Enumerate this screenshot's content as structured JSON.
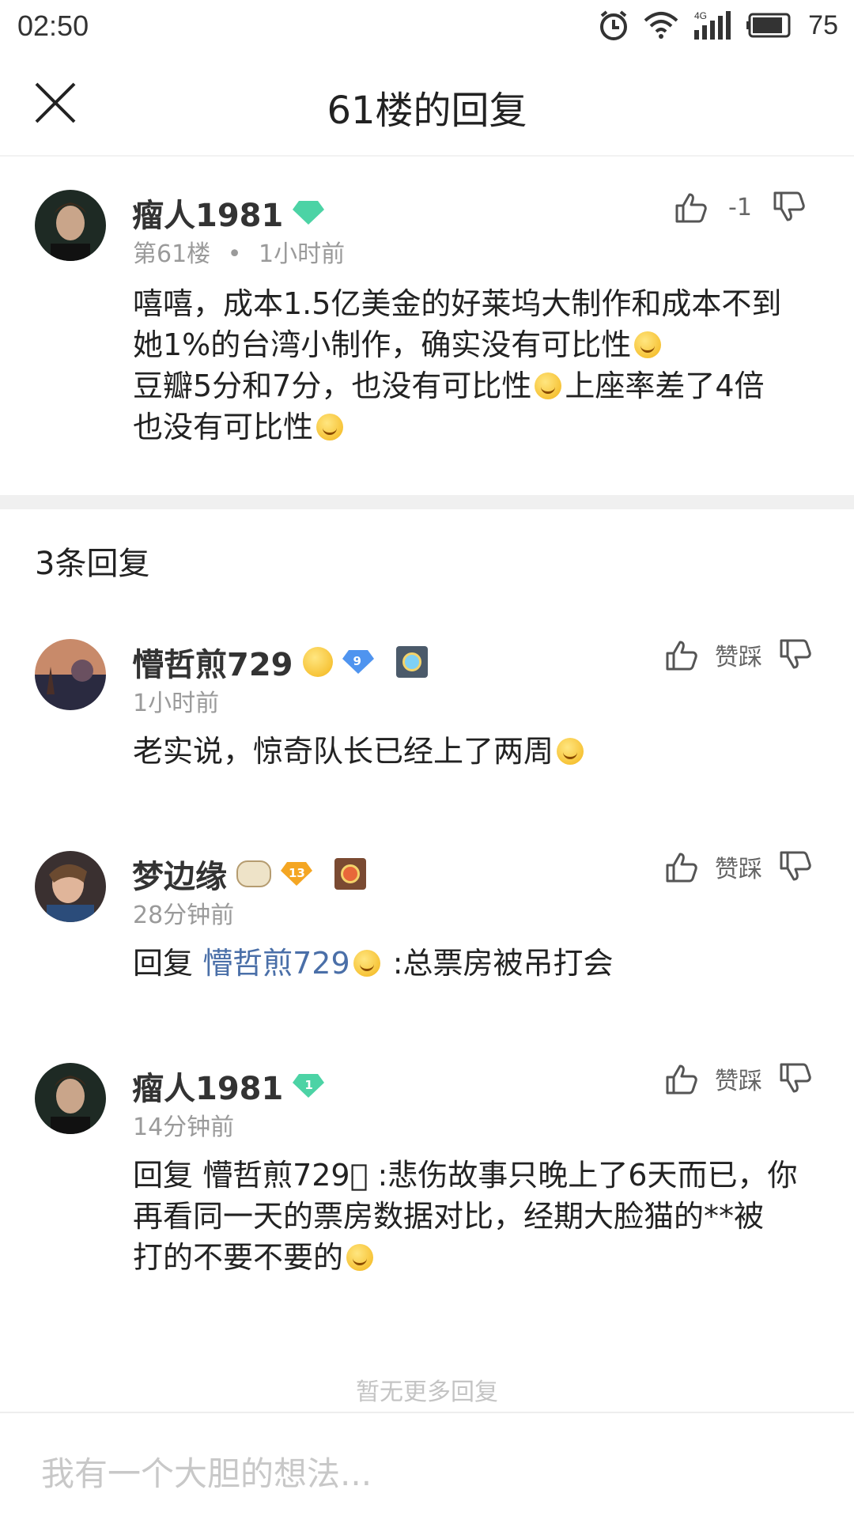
{
  "status_bar": {
    "time": "02:50",
    "battery": "75",
    "network": "4G"
  },
  "header": {
    "title": "61楼的回复"
  },
  "main_comment": {
    "username": "瘤人1981",
    "level": "1",
    "floor": "第61楼",
    "time": "1小时前",
    "vote_count": "-1",
    "text_line1": "嘻嘻，成本1.5亿美金的好莱坞大制作和成本不到",
    "text_line2": "她1%的台湾小制作，确实没有可比性",
    "text_line3a": "豆瓣5分和7分，也没有可比性",
    "text_line3b": "上座率差了4倍",
    "text_line4": "也没有可比性"
  },
  "replies_header": "3条回复",
  "vote_labels": {
    "like_dislike": "赞踩"
  },
  "replies": [
    {
      "username": "懵哲煎729",
      "level": "9",
      "time": "1小时前",
      "text": "老实说，惊奇队长已经上了两周"
    },
    {
      "username": "梦边缘",
      "level": "13",
      "time": "28分钟前",
      "prefix": "回复 ",
      "mention": "懵哲煎729",
      "text": " :总票房被吊打会"
    },
    {
      "username": "瘤人1981",
      "level": "1",
      "time": "14分钟前",
      "line1": "回复 懵哲煎729\u0000 :悲伤故事只晚上了6天而已，你",
      "line2": "再看同一天的票房数据对比，经期大脸猫的**被",
      "line3": "打的不要不要的"
    }
  ],
  "footer": {
    "no_more": "暂无更多回复",
    "input_placeholder": "我有一个大胆的想法..."
  },
  "colors": {
    "accent_link": "#4a6fa8",
    "level_green": "#4cd3a5",
    "level_blue": "#4f94ef",
    "level_orange": "#f4a623"
  }
}
